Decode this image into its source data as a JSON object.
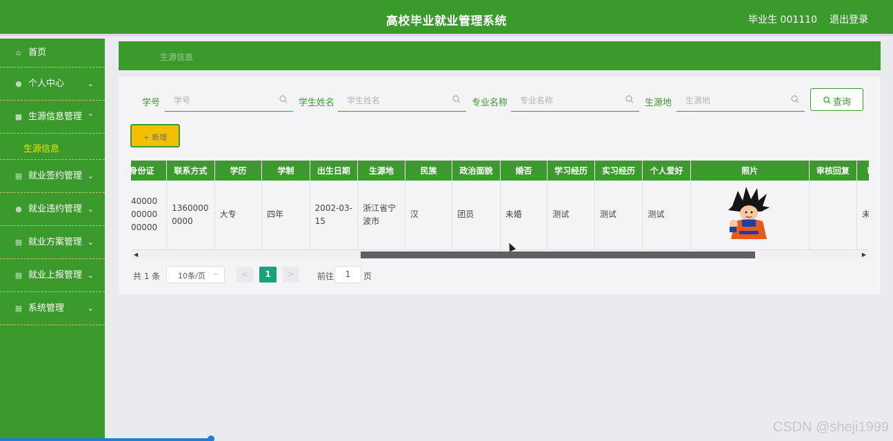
{
  "header": {
    "title": "高校毕业就业管理系统",
    "user": "毕业生 001110",
    "logout": "退出登录"
  },
  "sidebar": {
    "items": [
      {
        "label": "首页",
        "icon": "home-icon"
      },
      {
        "label": "个人中心",
        "icon": "user-icon",
        "chevron": "⌄"
      },
      {
        "label": "生源信息管理",
        "icon": "doc-icon",
        "chevron": "⌃"
      },
      {
        "label": "就业签约管理",
        "icon": "grid-icon",
        "chevron": "⌄"
      },
      {
        "label": "就业违约管理",
        "icon": "user-icon",
        "chevron": "⌄"
      },
      {
        "label": "就业方案管理",
        "icon": "grid-icon",
        "chevron": "⌄"
      },
      {
        "label": "就业上报管理",
        "icon": "grid-icon",
        "chevron": "⌄"
      },
      {
        "label": "系统管理",
        "icon": "grid-icon",
        "chevron": "⌄"
      }
    ],
    "submenu": {
      "label": "生源信息"
    }
  },
  "breadcrumb": {
    "current": "生源信息"
  },
  "search": {
    "fields": [
      {
        "label": "学号",
        "placeholder": "学号"
      },
      {
        "label": "学生姓名",
        "placeholder": "学生姓名"
      },
      {
        "label": "专业名称",
        "placeholder": "专业名称"
      },
      {
        "label": "生源地",
        "placeholder": "生源地"
      }
    ],
    "query_button": "查询"
  },
  "toolbar": {
    "add_button": "+ 新增"
  },
  "table": {
    "headers": [
      "身份证",
      "联系方式",
      "学历",
      "学制",
      "出生日期",
      "生源地",
      "民族",
      "政治面貌",
      "婚否",
      "学习经历",
      "实习经历",
      "个人爱好",
      "照片",
      "审核回复",
      "审核状态"
    ],
    "rows": [
      [
        "400000000000000",
        "13600000000",
        "大专",
        "四年",
        "2002-03-15",
        "浙江省宁波市",
        "汉",
        "团员",
        "未婚",
        "测试",
        "测试",
        "测试",
        "",
        "",
        "未通过"
      ]
    ]
  },
  "pagination": {
    "total": "共 1 条",
    "page_size": "10条/页",
    "current_page": "1",
    "goto_label": "前往",
    "goto_value": "1",
    "goto_suffix": "页"
  },
  "watermark": "CSDN @sheji1999",
  "colors": {
    "primary": "#3a9b2c",
    "accent": "#f2c000",
    "page_active": "#14a37a"
  }
}
